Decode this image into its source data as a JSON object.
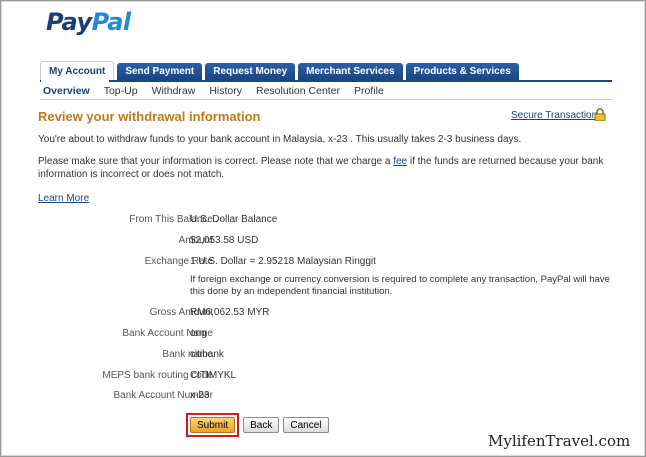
{
  "brand": {
    "part1": "Pay",
    "part2": "Pal"
  },
  "tabs": [
    {
      "label": "My Account",
      "active": true
    },
    {
      "label": "Send Payment",
      "active": false
    },
    {
      "label": "Request Money",
      "active": false
    },
    {
      "label": "Merchant Services",
      "active": false
    },
    {
      "label": "Products & Services",
      "active": false
    }
  ],
  "subnav": [
    "Overview",
    "Top-Up",
    "Withdraw",
    "History",
    "Resolution Center",
    "Profile"
  ],
  "page": {
    "title": "Review your withdrawal information",
    "secure_link": "Secure Transaction",
    "intro": "You're about to withdraw funds to your bank account in Malaysia, x-23      . This usually takes 2-3 business days.",
    "check_before": "Please make sure that your information is correct. Please note that we charge a ",
    "check_link": "fee",
    "check_after": " if the funds are returned because your bank information is incorrect or does not match.",
    "learn_more": "Learn More"
  },
  "details": [
    {
      "label": "From This Balance",
      "value": "U.S. Dollar Balance"
    },
    {
      "label": "Amount",
      "value": "$2,053.58 USD"
    },
    {
      "label": "Exchange Rate",
      "value": "1 U.S. Dollar = 2.95218 Malaysian Ringgit"
    },
    {
      "label": "Gross Amount",
      "value": "RM6,062.53 MYR"
    },
    {
      "label": "Bank Account Name",
      "value": "ong"
    },
    {
      "label": "Bank name",
      "value": "citibank"
    },
    {
      "label": "MEPS bank routing code",
      "value": "CITIMYKL"
    },
    {
      "label": "Bank Account Number",
      "value": "x-23"
    }
  ],
  "conversion_note": "If foreign exchange or currency conversion is required to complete any transaction, PayPal will have this done by an independent financial institution.",
  "buttons": {
    "submit": "Submit",
    "back": "Back",
    "cancel": "Cancel"
  },
  "watermark": "MylifenTravel.com",
  "colors": {
    "accent": "#c07820",
    "nav": "#1a4585",
    "highlight": "#d11a1a"
  }
}
